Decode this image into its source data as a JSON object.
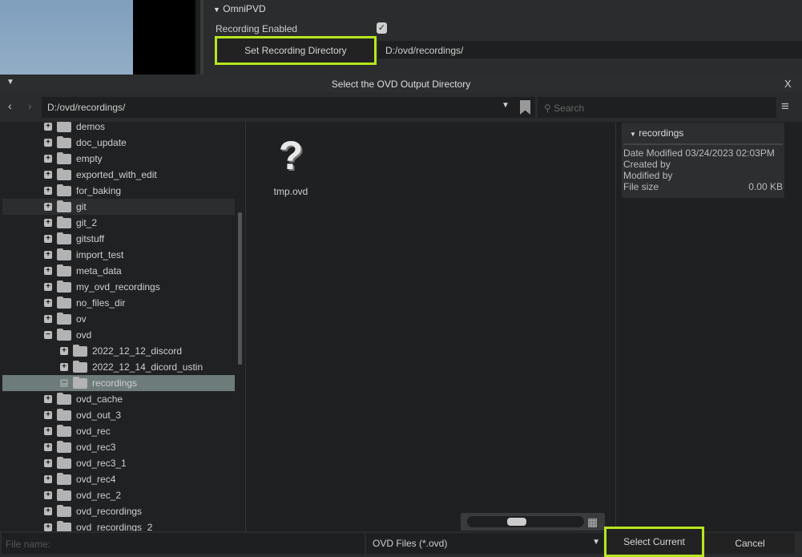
{
  "top_panel": {
    "section": "OmniPVD",
    "recording_enabled_label": "Recording Enabled",
    "recording_enabled": true,
    "set_dir_button": "Set Recording Directory",
    "dir_value": "D:/ovd/recordings/"
  },
  "dialog": {
    "title": "Select the OVD Output Directory",
    "close": "X",
    "path": "D:/ovd/recordings/",
    "search_placeholder": "Search",
    "tree": [
      {
        "label": "demos",
        "level": 0,
        "state": "collapsed"
      },
      {
        "label": "doc_update",
        "level": 0,
        "state": "collapsed"
      },
      {
        "label": "empty",
        "level": 0,
        "state": "collapsed"
      },
      {
        "label": "exported_with_edit",
        "level": 0,
        "state": "collapsed"
      },
      {
        "label": "for_baking",
        "level": 0,
        "state": "collapsed"
      },
      {
        "label": "git",
        "level": 0,
        "state": "collapsed",
        "hover": true
      },
      {
        "label": "git_2",
        "level": 0,
        "state": "collapsed"
      },
      {
        "label": "gitstuff",
        "level": 0,
        "state": "collapsed"
      },
      {
        "label": "import_test",
        "level": 0,
        "state": "collapsed"
      },
      {
        "label": "meta_data",
        "level": 0,
        "state": "collapsed"
      },
      {
        "label": "my_ovd_recordings",
        "level": 0,
        "state": "collapsed"
      },
      {
        "label": "no_files_dir",
        "level": 0,
        "state": "collapsed"
      },
      {
        "label": "ov",
        "level": 0,
        "state": "collapsed"
      },
      {
        "label": "ovd",
        "level": 0,
        "state": "expanded"
      },
      {
        "label": "2022_12_12_discord",
        "level": 1,
        "state": "collapsed"
      },
      {
        "label": "2022_12_14_dicord_ustin",
        "level": 1,
        "state": "collapsed"
      },
      {
        "label": "recordings",
        "level": 1,
        "state": "expanded",
        "selected": true
      },
      {
        "label": "ovd_cache",
        "level": 0,
        "state": "collapsed"
      },
      {
        "label": "ovd_out_3",
        "level": 0,
        "state": "collapsed"
      },
      {
        "label": "ovd_rec",
        "level": 0,
        "state": "collapsed"
      },
      {
        "label": "ovd_rec3",
        "level": 0,
        "state": "collapsed"
      },
      {
        "label": "ovd_rec3_1",
        "level": 0,
        "state": "collapsed"
      },
      {
        "label": "ovd_rec4",
        "level": 0,
        "state": "collapsed"
      },
      {
        "label": "ovd_rec_2",
        "level": 0,
        "state": "collapsed"
      },
      {
        "label": "ovd_recordings",
        "level": 0,
        "state": "collapsed"
      },
      {
        "label": "ovd_recordings_2",
        "level": 0,
        "state": "collapsed"
      }
    ],
    "files": [
      {
        "name": "tmp.ovd",
        "icon": "question-mark-icon"
      }
    ],
    "info": {
      "title": "recordings",
      "date_modified_label": "Date Modified",
      "date_modified": "03/24/2023 02:03PM",
      "created_by_label": "Created by",
      "modified_by_label": "Modified by",
      "file_size_label": "File size",
      "file_size": "0.00 KB"
    },
    "filename_placeholder": "File name:",
    "filter": "OVD Files (*.ovd)",
    "select_button": "Select Current",
    "cancel_button": "Cancel"
  },
  "colors": {
    "highlight": "#b7e61e",
    "selected_row": "#6d7b7b"
  }
}
